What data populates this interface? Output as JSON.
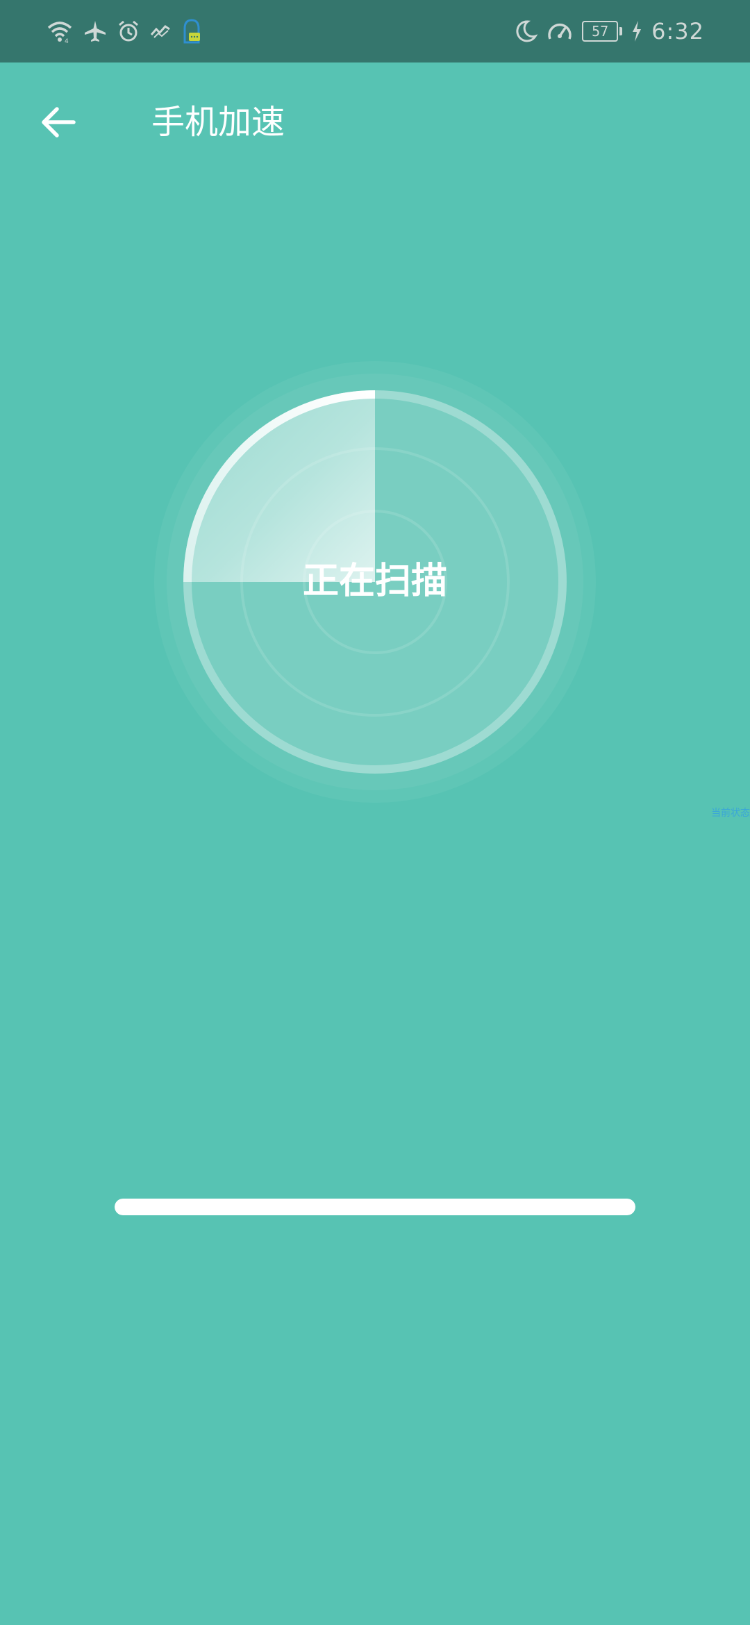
{
  "status_bar": {
    "battery_level": "57",
    "time": "6:32",
    "left_icons": [
      "wifi-icon",
      "airplane-icon",
      "alarm-icon",
      "signal-icon",
      "app-notification-icon"
    ],
    "right_icons": [
      "moon-icon",
      "speed-meter-icon",
      "battery-icon",
      "charging-icon"
    ]
  },
  "header": {
    "title": "手机加速"
  },
  "scanner": {
    "status_text": "正在扫描",
    "sweep_angle_deg": 90
  },
  "progress": {
    "fraction": 1.0
  },
  "tiny_label": "当前状态",
  "colors": {
    "background": "#57c3b3",
    "status_bar": "#35766d",
    "accent": "#ffffff"
  }
}
